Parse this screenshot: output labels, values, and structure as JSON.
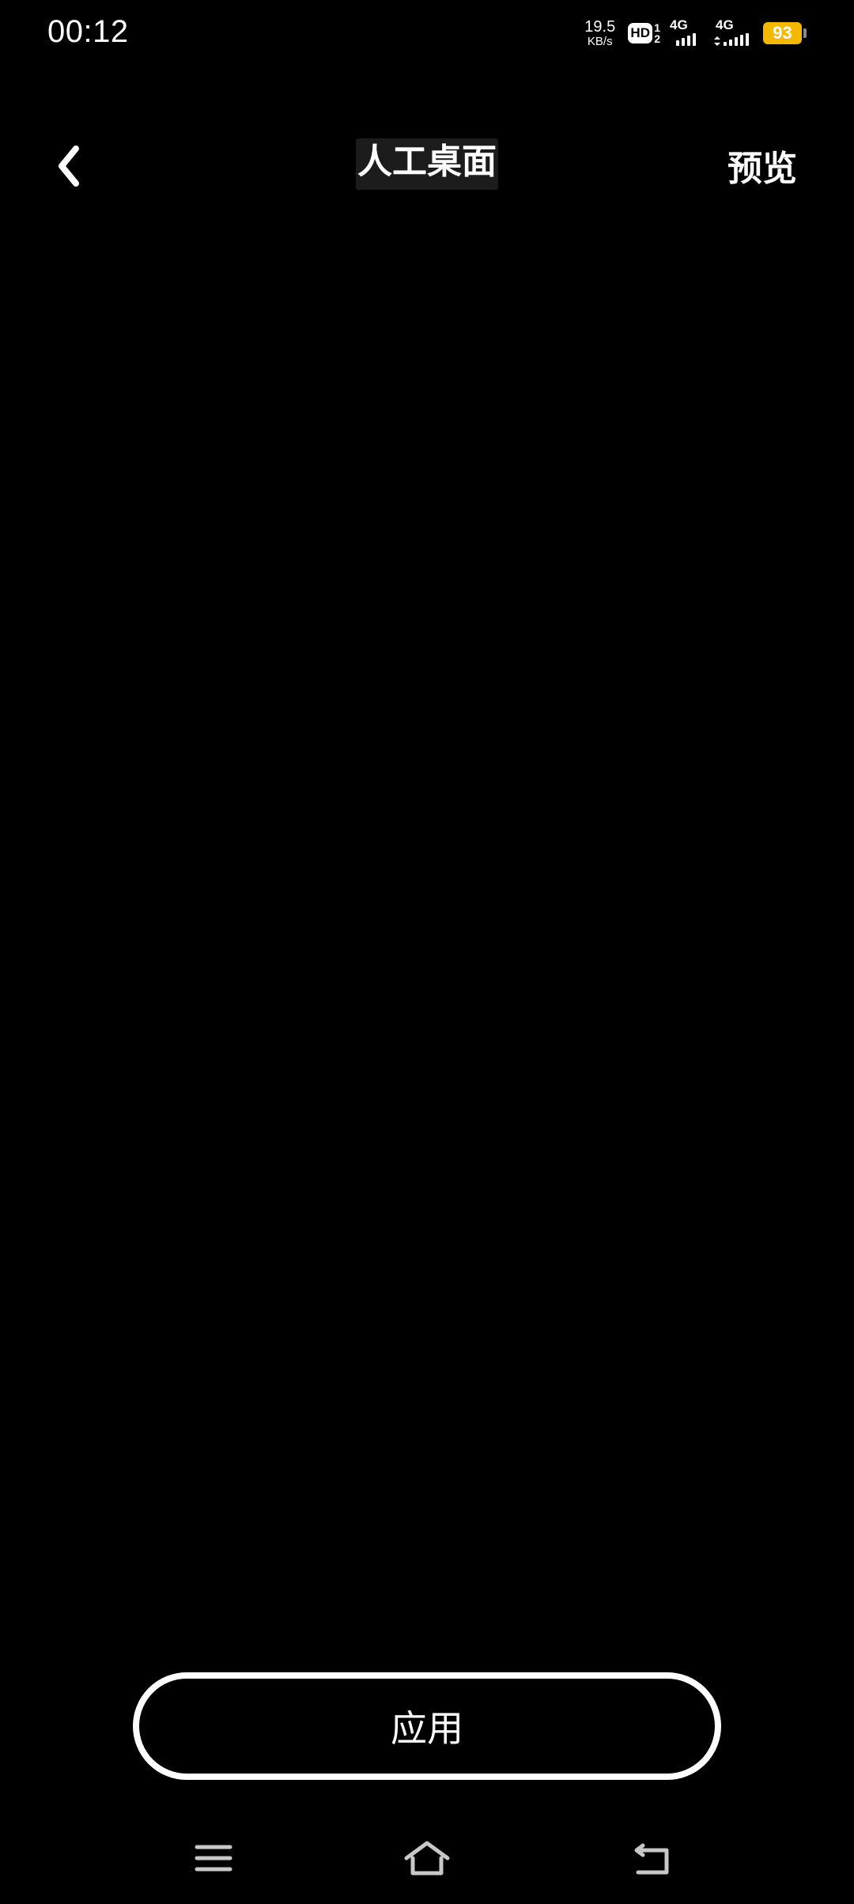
{
  "status_bar": {
    "time": "00:12",
    "net_speed_value": "19.5",
    "net_speed_unit": "KB/s",
    "hd_label": "HD",
    "hd_sub_top": "1",
    "hd_sub_bottom": "2",
    "sim1_label": "4G",
    "sim2_label": "4G",
    "battery_level": "93",
    "battery_color": "#f5b800",
    "icons": [
      "hd-voice-icon",
      "signal-icon",
      "signal-icon",
      "battery-icon"
    ]
  },
  "header": {
    "back_icon": "chevron-left-icon",
    "title": "人工桌面",
    "preview_label": "预览"
  },
  "main": {
    "apply_label": "应用"
  },
  "nav_bar": {
    "icons": [
      "menu-icon",
      "home-icon",
      "back-icon"
    ]
  }
}
